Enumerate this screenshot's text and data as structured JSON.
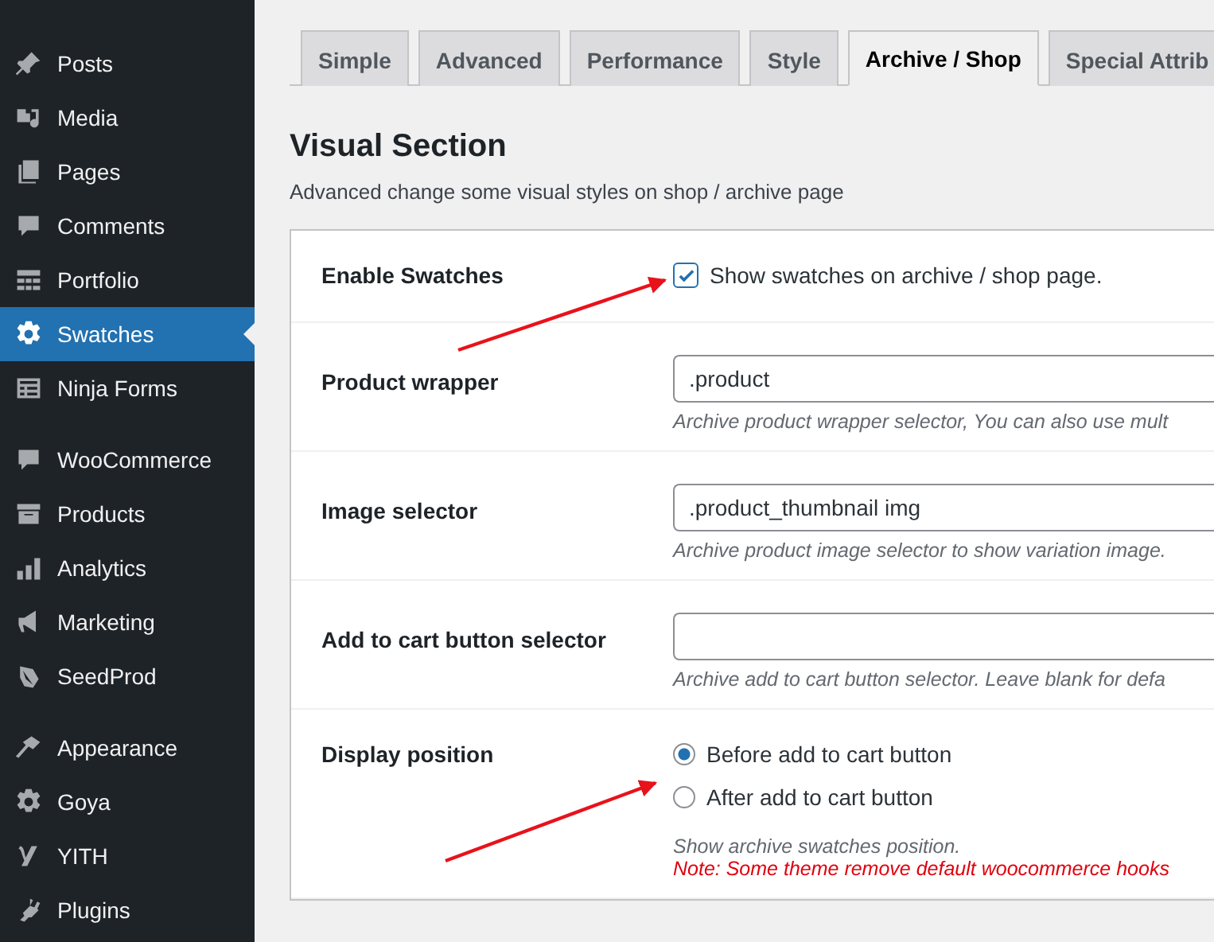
{
  "sidebar": {
    "groups": [
      {
        "items": [
          {
            "label": "Posts",
            "selected": false
          },
          {
            "label": "Media",
            "selected": false
          },
          {
            "label": "Pages",
            "selected": false
          },
          {
            "label": "Comments",
            "selected": false
          },
          {
            "label": "Portfolio",
            "selected": false
          },
          {
            "label": "Swatches",
            "selected": true
          },
          {
            "label": "Ninja Forms",
            "selected": false
          }
        ]
      },
      {
        "items": [
          {
            "label": "WooCommerce",
            "selected": false
          },
          {
            "label": "Products",
            "selected": false
          },
          {
            "label": "Analytics",
            "selected": false
          },
          {
            "label": "Marketing",
            "selected": false
          },
          {
            "label": "SeedProd",
            "selected": false
          }
        ]
      },
      {
        "items": [
          {
            "label": "Appearance",
            "selected": false
          },
          {
            "label": "Goya",
            "selected": false
          },
          {
            "label": "YITH",
            "selected": false
          },
          {
            "label": "Plugins",
            "selected": false
          }
        ]
      }
    ]
  },
  "tabs": [
    {
      "label": "Simple",
      "selected": false
    },
    {
      "label": "Advanced",
      "selected": false
    },
    {
      "label": "Performance",
      "selected": false
    },
    {
      "label": "Style",
      "selected": false
    },
    {
      "label": "Archive / Shop",
      "selected": true
    },
    {
      "label": "Special Attrib",
      "selected": false
    }
  ],
  "section": {
    "title": "Visual Section",
    "description": "Advanced change some visual styles on shop / archive page"
  },
  "settings": [
    {
      "kind": "checkbox",
      "label": "Enable Swatches",
      "checked": true,
      "text": "Show swatches on archive / shop page."
    },
    {
      "kind": "text",
      "label": "Product wrapper",
      "value": ".product",
      "help": "Archive product wrapper selector, You can also use mult"
    },
    {
      "kind": "text",
      "label": "Image selector",
      "value": ".product_thumbnail img",
      "help": "Archive product image selector to show variation image."
    },
    {
      "kind": "text",
      "label": "Add to cart button selector",
      "help": "Archive add to cart button selector. Leave blank for defa"
    },
    {
      "kind": "radio",
      "label": "Display position",
      "options": [
        {
          "label": "Before add to cart button",
          "selected": true
        },
        {
          "label": "After add to cart button",
          "selected": false
        }
      ],
      "help": "Show archive swatches position.",
      "note": "Note: Some theme remove default woocommerce hooks"
    }
  ]
}
